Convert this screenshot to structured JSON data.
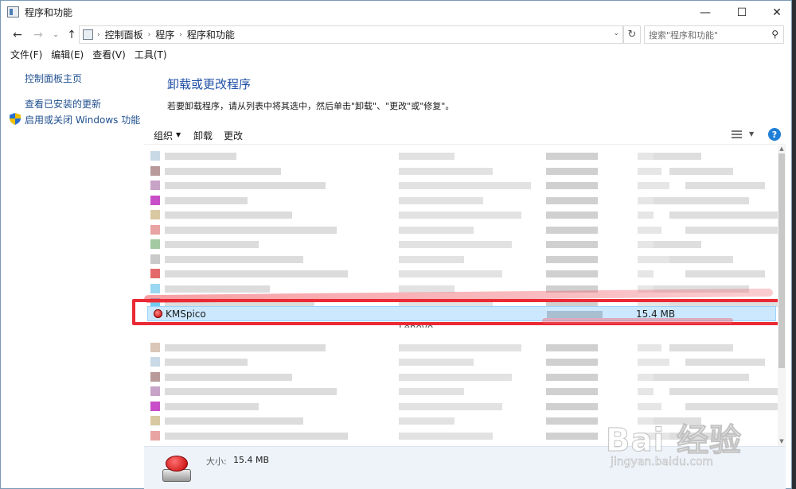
{
  "window": {
    "title": "程序和功能",
    "minimize": "—",
    "maximize": "☐",
    "close": "✕"
  },
  "nav": {
    "back": "←",
    "forward": "→",
    "dropdown": "⌄",
    "up": "↑",
    "breadcrumbs": [
      "控制面板",
      "程序",
      "程序和功能"
    ],
    "breadcrumb_sep": "›",
    "refresh": "↻",
    "search_placeholder": "搜索\"程序和功能\""
  },
  "menu": [
    "文件(F)",
    "编辑(E)",
    "查看(V)",
    "工具(T)"
  ],
  "sidebar": {
    "home": "控制面板主页",
    "updates": "查看已安装的更新",
    "features": "启用或关闭 Windows 功能"
  },
  "content": {
    "title": "卸载或更改程序",
    "description": "若要卸载程序，请从列表中将其选中，然后单击\"卸载\"、\"更改\"或\"修复\"。"
  },
  "toolbar": {
    "organize": "组织",
    "uninstall": "卸载",
    "change": "更改",
    "help": "?"
  },
  "selected_program": {
    "name": "KMSpico",
    "size": "15.4 MB"
  },
  "partial_publisher": "Lenovo",
  "details": {
    "size_label": "大小:",
    "size_value": "15.4 MB"
  },
  "watermark": {
    "main": "Bai 经验",
    "sub": "jingyan.baidu.com"
  },
  "colors": {
    "link": "#1f4f8f",
    "heading": "#1e4ea6",
    "selection": "#cce8ff",
    "annotation_red": "#ea2a35"
  }
}
